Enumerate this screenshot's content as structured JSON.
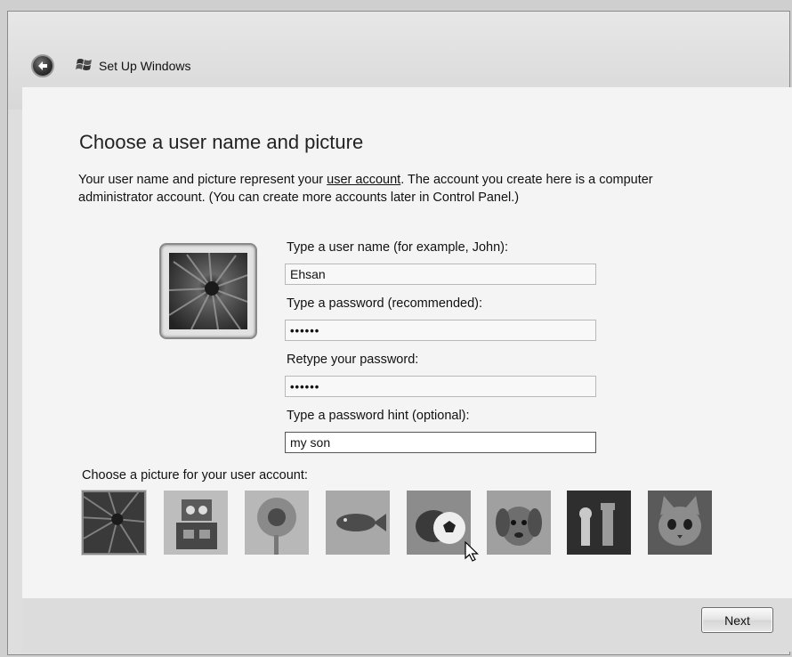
{
  "window": {
    "title": "Set Up Windows"
  },
  "page": {
    "heading": "Choose a user name and picture",
    "intro_before_link": "Your user name and picture represent your ",
    "intro_link": "user account",
    "intro_after_link": ". The account you create here is a computer administrator account. (You can create more accounts later in Control Panel.)"
  },
  "form": {
    "username_label": "Type a user name (for example, John):",
    "username_value": "Ehsan",
    "password_label": "Type a password (recommended):",
    "password_value": "••••••",
    "retype_label": "Retype your password:",
    "retype_value": "••••••",
    "hint_label": "Type a password hint (optional):",
    "hint_value": "my son"
  },
  "pictures": {
    "label": "Choose a picture for your user account:",
    "items": [
      "flower",
      "robot",
      "flower-2",
      "fish",
      "soccer-ball-dog",
      "puppy",
      "chess",
      "kitten"
    ],
    "selected_index": 0
  },
  "footer": {
    "next_label": "Next"
  }
}
